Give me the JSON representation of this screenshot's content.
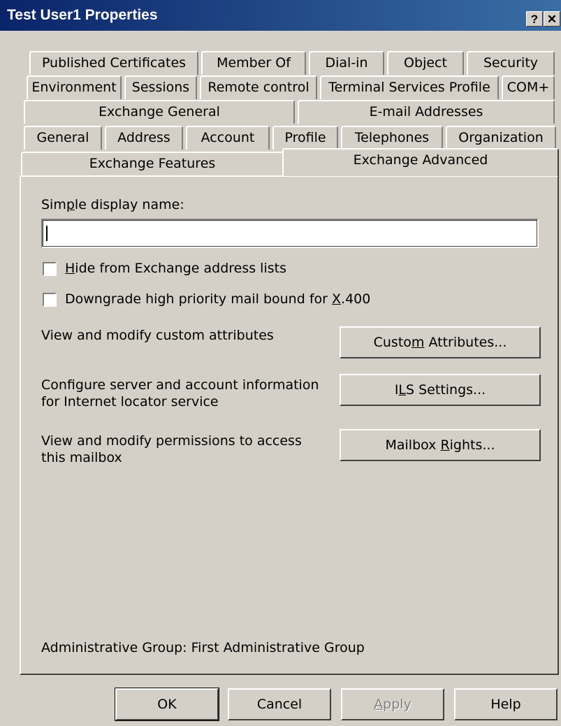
{
  "window": {
    "title": "Test User1 Properties",
    "help_button": "?",
    "close_button": "✕"
  },
  "tabs": {
    "row1": [
      "Published Certificates",
      "Member Of",
      "Dial-in",
      "Object",
      "Security"
    ],
    "row2": [
      "Environment",
      "Sessions",
      "Remote control",
      "Terminal Services Profile",
      "COM+"
    ],
    "row3": [
      "Exchange General",
      "E-mail Addresses"
    ],
    "row4": [
      "General",
      "Address",
      "Account",
      "Profile",
      "Telephones",
      "Organization"
    ],
    "row5": [
      "Exchange Features",
      "Exchange Advanced"
    ],
    "active": "Exchange Advanced"
  },
  "form": {
    "display_name_label": {
      "pre": "Sim",
      "key": "p",
      "post": "le display name:"
    },
    "display_name_value": "",
    "hide_checkbox": {
      "pre": "",
      "key": "H",
      "post": "ide from Exchange address lists",
      "checked": false
    },
    "downgrade_checkbox": {
      "pre": "Downgrade high priority mail bound for ",
      "key": "X",
      "post": ".400",
      "checked": false
    },
    "custom_attr_desc": "View and modify custom attributes",
    "custom_attr_button": {
      "pre": "Custo",
      "key": "m",
      "post": " Attributes..."
    },
    "ils_desc_line1": "Configure server and account information",
    "ils_desc_line2": "for Internet locator service",
    "ils_button": {
      "pre": "I",
      "key": "L",
      "post": "S Settings..."
    },
    "mailbox_desc_line1": "View and modify permissions to access",
    "mailbox_desc_line2": "this mailbox",
    "mailbox_button": {
      "pre": "Mailbox ",
      "key": "R",
      "post": "ights..."
    },
    "admin_group": "Administrative Group: First Administrative Group"
  },
  "footer": {
    "ok": "OK",
    "cancel": "Cancel",
    "apply": {
      "pre": "",
      "key": "A",
      "post": "pply"
    },
    "help": "Help"
  }
}
